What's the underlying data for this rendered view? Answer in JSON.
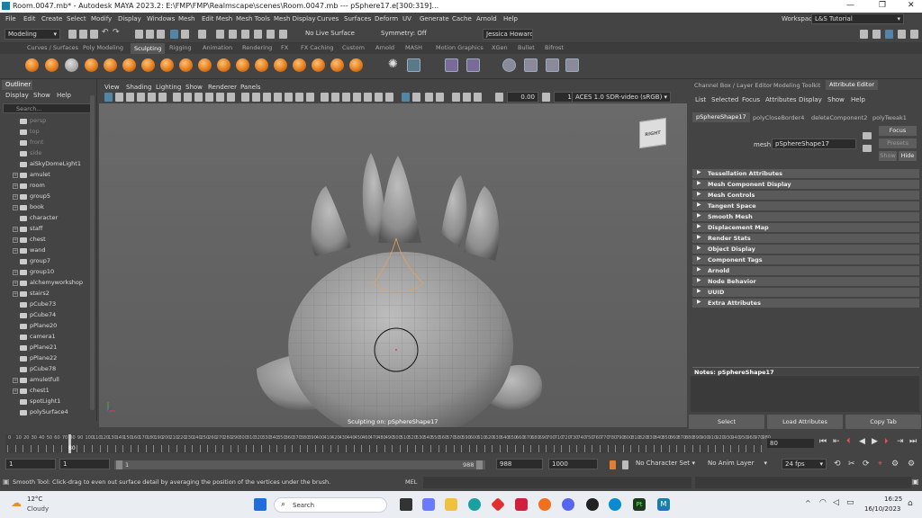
{
  "titlebar": {
    "title": "Room.0047.mb* - Autodesk MAYA 2023.2: E:\\FMP\\FMP\\Realmscape\\scenes\\Room.0047.mb   ---   pSphere17.e[300:319]...",
    "minimize": "—",
    "maximize": "❐",
    "close": "✕"
  },
  "menubar": {
    "items": [
      "File",
      "Edit",
      "Create",
      "Select",
      "Modify",
      "Display",
      "Windows",
      "Mesh",
      "Edit Mesh",
      "Mesh Tools",
      "Mesh Display",
      "Curves",
      "Surfaces",
      "Deform",
      "UV",
      "Generate",
      "Cache",
      "Arnold",
      "Help"
    ],
    "workspace_label": "Workspace:",
    "workspace_value": "L&S Tutorial"
  },
  "statusline": {
    "mode": "Modeling",
    "live": "No Live Surface",
    "symmetry": "Symmetry: Off",
    "user": "Jessica Howard"
  },
  "shelf": {
    "tabs": [
      "Curves / Surfaces",
      "Poly Modeling",
      "Sculpting",
      "Rigging",
      "Animation",
      "Rendering",
      "FX",
      "FX Caching",
      "Custom",
      "Arnold",
      "MASH",
      "Motion Graphics",
      "XGen",
      "Bullet",
      "Bifrost"
    ],
    "active_tab": "Sculpting"
  },
  "outliner": {
    "title": "Outliner",
    "menu": [
      "Display",
      "Show",
      "Help"
    ],
    "search_placeholder": "Search...",
    "items": [
      {
        "label": "persp",
        "dim": true,
        "expand": false
      },
      {
        "label": "top",
        "dim": true,
        "expand": false
      },
      {
        "label": "front",
        "dim": true,
        "expand": false
      },
      {
        "label": "side",
        "dim": true,
        "expand": false
      },
      {
        "label": "aiSkyDomeLight1",
        "dim": false,
        "expand": false
      },
      {
        "label": "amulet",
        "dim": false,
        "expand": true
      },
      {
        "label": "room",
        "dim": false,
        "expand": true
      },
      {
        "label": "group5",
        "dim": false,
        "expand": true
      },
      {
        "label": "book",
        "dim": false,
        "expand": true
      },
      {
        "label": "character",
        "dim": false,
        "expand": false
      },
      {
        "label": "staff",
        "dim": false,
        "expand": true
      },
      {
        "label": "chest",
        "dim": false,
        "expand": true
      },
      {
        "label": "wand",
        "dim": false,
        "expand": true
      },
      {
        "label": "group7",
        "dim": false,
        "expand": false
      },
      {
        "label": "group10",
        "dim": false,
        "expand": true
      },
      {
        "label": "alchemyworkshop",
        "dim": false,
        "expand": true
      },
      {
        "label": "stairs2",
        "dim": false,
        "expand": true
      },
      {
        "label": "pCube73",
        "dim": false,
        "expand": false
      },
      {
        "label": "pCube74",
        "dim": false,
        "expand": false
      },
      {
        "label": "pPlane20",
        "dim": false,
        "expand": false
      },
      {
        "label": "camera1",
        "dim": false,
        "expand": false
      },
      {
        "label": "pPlane21",
        "dim": false,
        "expand": false
      },
      {
        "label": "pPlane22",
        "dim": false,
        "expand": false
      },
      {
        "label": "pCube78",
        "dim": false,
        "expand": false
      },
      {
        "label": "amuletfull",
        "dim": false,
        "expand": true
      },
      {
        "label": "chest1",
        "dim": false,
        "expand": true
      },
      {
        "label": "spotLight1",
        "dim": false,
        "expand": false
      },
      {
        "label": "polySurface4",
        "dim": false,
        "expand": false
      }
    ]
  },
  "viewport": {
    "menu": [
      "View",
      "Shading",
      "Lighting",
      "Show",
      "Renderer",
      "Panels"
    ],
    "field_a": "0.00",
    "field_b": "1.00",
    "colorspace": "ACES 1.0 SDR-video (sRGB)",
    "cube_label": "RIGHT",
    "status": "Sculpting on: pSphereShape17"
  },
  "attribute_editor": {
    "top_tabs": [
      "Channel Box / Layer Editor",
      "Modeling Toolkit",
      "Attribute Editor"
    ],
    "active_top_tab": "Attribute Editor",
    "menu": [
      "List",
      "Selected",
      "Focus",
      "Attributes",
      "Display",
      "Show",
      "Help"
    ],
    "node_tabs": [
      "pSphereShape17",
      "polyCloseBorder4",
      "deleteComponent2",
      "polyTweak1"
    ],
    "mesh_label": "mesh:",
    "mesh_value": "pSphereShape17",
    "focus": "Focus",
    "presets": "Presets",
    "show": "Show",
    "hide": "Hide",
    "sections": [
      "Tessellation Attributes",
      "Mesh Component Display",
      "Mesh Controls",
      "Tangent Space",
      "Smooth Mesh",
      "Displacement Map",
      "Render Stats",
      "Object Display",
      "Component Tags",
      "Arnold",
      "Node Behavior",
      "UUID",
      "Extra Attributes"
    ],
    "notes": "Notes:  pSphereShape17",
    "buttons": [
      "Select",
      "Load Attributes",
      "Copy Tab"
    ]
  },
  "timeline": {
    "ticks": [
      "0",
      "10",
      "20",
      "30",
      "40",
      "50",
      "60",
      "70",
      "80",
      "90",
      "100",
      "110",
      "120",
      "130",
      "140",
      "150",
      "160",
      "170",
      "180",
      "190",
      "200",
      "210",
      "220",
      "230",
      "240",
      "250",
      "260",
      "270",
      "280",
      "290",
      "300",
      "310",
      "320",
      "330",
      "340",
      "350",
      "360",
      "370",
      "380",
      "390",
      "400",
      "410",
      "420",
      "430",
      "440",
      "450",
      "460",
      "470",
      "480",
      "490",
      "500",
      "510",
      "520",
      "530",
      "540",
      "550",
      "560",
      "570",
      "580",
      "590",
      "600",
      "610",
      "620",
      "630",
      "640",
      "650",
      "660",
      "670",
      "680",
      "690",
      "700",
      "710",
      "720",
      "730",
      "740",
      "750",
      "760",
      "770",
      "780",
      "790",
      "800",
      "810",
      "820",
      "830",
      "840",
      "850",
      "860",
      "870",
      "880",
      "890",
      "900",
      "910",
      "920",
      "930",
      "940",
      "950",
      "960",
      "970",
      "980"
    ],
    "current_marker": "80",
    "current_field": "80"
  },
  "range": {
    "start_a": "1",
    "start_b": "1",
    "slider_start": "1",
    "slider_end": "988",
    "end_a": "988",
    "end_b": "1000",
    "char_set": "No Character Set",
    "anim_layer": "No Anim Layer",
    "fps": "24 fps"
  },
  "cmdline": {
    "help": "Smooth Tool: Click-drag to even out surface detail by averaging the position of the vertices under the brush.",
    "mel": "MEL"
  },
  "taskbar": {
    "weather_temp": "12°C",
    "weather_desc": "Cloudy",
    "search": "Search",
    "time": "16:25",
    "date": "16/10/2023"
  }
}
